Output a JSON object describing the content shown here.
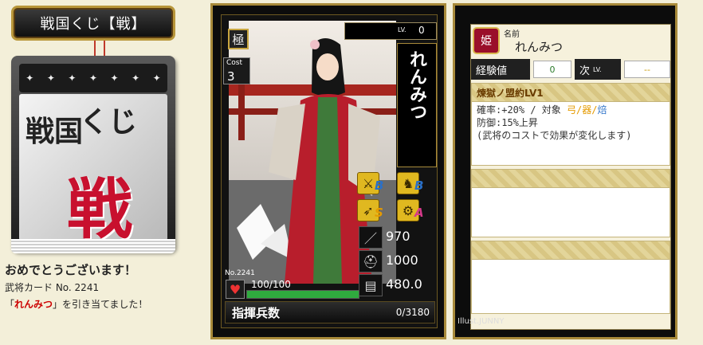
{
  "left": {
    "title": "戦国くじ【戦】",
    "pad_strip": [
      "✦",
      "✦",
      "✦",
      "✦",
      "✦",
      "✦",
      "✦"
    ],
    "pad_kanji_1": "戦国",
    "pad_kanji_2": "くじ",
    "pad_kanji_3": "戦",
    "congrats": "おめでとうございます！",
    "card_line": "武将カード No. 2241",
    "result_prefix": "「",
    "result_name": "れんみつ",
    "result_suffix": "」を引き当てました！"
  },
  "card": {
    "rarity": "極",
    "cost_label": "Cost",
    "cost_value": "3",
    "lv_label": "LV.",
    "lv_value": "0",
    "name": "れんみつ",
    "aptitudes": [
      {
        "icon": "spear-icon",
        "glyph": "⚔",
        "grade": "B",
        "color": "#2a70c8"
      },
      {
        "icon": "horse-icon",
        "glyph": "♞",
        "grade": "B",
        "color": "#2a70c8"
      },
      {
        "icon": "bow-icon",
        "glyph": "➶",
        "grade": "S",
        "color": "#e59a00"
      },
      {
        "icon": "siege-icon",
        "glyph": "⚙",
        "grade": "A",
        "color": "#d63a8a"
      }
    ],
    "attack": "970",
    "defense": "1000",
    "speed": "480.0",
    "number": "No.2241",
    "hp": "100/100",
    "hp_fraction": 1.0,
    "troops_label": "指揮兵数",
    "troops_value": "0/3180"
  },
  "back": {
    "crest": "姫",
    "name_label": "名前",
    "name_value": "れんみつ",
    "xp_label": "経験値",
    "xp_value": "0",
    "next_label": "次",
    "next_lv": "LV.",
    "next_value": "--",
    "skill_title": "煉獄ノ盟約LV1",
    "skill_line1_a": "確率:+20%  /  対象 ",
    "skill_w1": "弓",
    "skill_sep1": "/",
    "skill_w2": "器",
    "skill_sep2": "/",
    "skill_w3": "焙",
    "skill_line2": "防御:15%上昇",
    "skill_line3": "(武将のコストで効果が変化します)",
    "illust": "Illust.JUNNY"
  },
  "colors": {
    "background": "#f3efd9",
    "gold": "#a88a3a",
    "red": "#c8102e",
    "hp_green": "#2faa3e"
  }
}
